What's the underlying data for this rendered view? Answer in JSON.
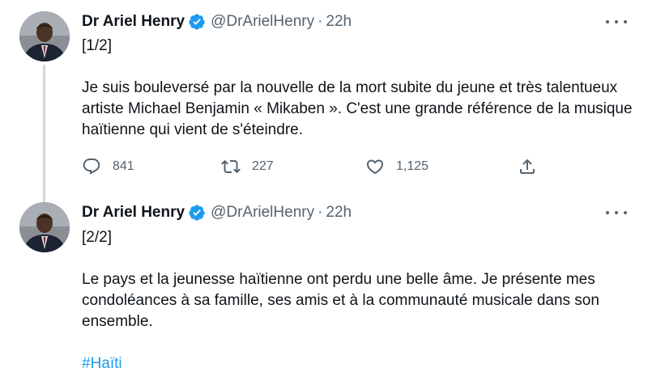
{
  "tweets": [
    {
      "author": {
        "name": "Dr Ariel Henry",
        "handle": "@DrArielHenry"
      },
      "time": "22h",
      "dot": "·",
      "thread_marker": "[1/2]",
      "body": "Je suis bouleversé par la nouvelle de la mort subite du jeune et très talentueux artiste Michael Benjamin « Mikaben ». C'est une grande référence de la musique haïtienne qui vient de s'éteindre.",
      "stats": {
        "replies": "841",
        "retweets": "227",
        "likes": "1,125"
      }
    },
    {
      "author": {
        "name": "Dr Ariel Henry",
        "handle": "@DrArielHenry"
      },
      "time": "22h",
      "dot": "·",
      "thread_marker": "[2/2]",
      "body": "Le pays et la jeunesse haïtienne ont perdu une belle âme. Je présente mes condoléances à sa famille, ses amis et à la communauté musicale dans son ensemble.",
      "hashtag": "#Haïti"
    }
  ],
  "icons": {
    "verified": "verified-badge-icon",
    "more": "more-options-icon",
    "reply": "reply-icon",
    "retweet": "retweet-icon",
    "like": "like-icon",
    "share": "share-icon"
  },
  "colors": {
    "verified_blue": "#1d9bf0",
    "link_blue": "#1d9bf0",
    "muted": "#536471",
    "thread_line": "#cfd9de"
  }
}
